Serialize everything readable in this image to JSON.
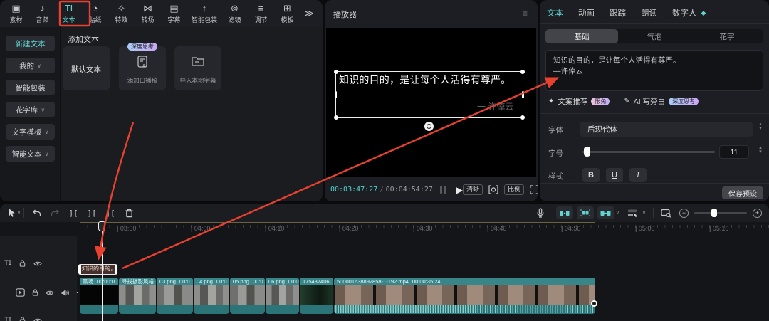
{
  "icons": {
    "more": "≫",
    "chevron_down": "∨",
    "play": "▶",
    "split": "][",
    "ellipsis": "⋯",
    "hamburger": "≡",
    "sparkle": "✦",
    "pen": "✎",
    "track_text": "TI",
    "stepper_up": "▴",
    "stepper_down": "▾",
    "minus": "−",
    "plus": "+",
    "diamond": "◆"
  },
  "toolbar": {
    "items": [
      {
        "label": "素材",
        "glyph": "▣"
      },
      {
        "label": "音频",
        "glyph": "♪"
      },
      {
        "label": "文本",
        "glyph": "TI"
      },
      {
        "label": "贴纸",
        "glyph": "◔"
      },
      {
        "label": "特效",
        "glyph": "✧"
      },
      {
        "label": "转场",
        "glyph": "⋈"
      },
      {
        "label": "字幕",
        "glyph": "▤"
      },
      {
        "label": "智能包装",
        "glyph": "↑"
      },
      {
        "label": "滤镜",
        "glyph": "⊚"
      },
      {
        "label": "调节",
        "glyph": "≡"
      },
      {
        "label": "模板",
        "glyph": "⊞"
      }
    ]
  },
  "sidebar": {
    "items": [
      {
        "label": "新建文本"
      },
      {
        "label": "我的"
      },
      {
        "label": "智能包装"
      },
      {
        "label": "花字库"
      },
      {
        "label": "文字模板"
      },
      {
        "label": "智能文本"
      }
    ]
  },
  "add_text": {
    "title": "添加文本",
    "cards": [
      {
        "label": "默认文本"
      },
      {
        "label": "添加口播稿",
        "badge": "深度思考"
      },
      {
        "label": "导入本地字幕"
      }
    ]
  },
  "player": {
    "title": "播放器",
    "overlay_text": "知识的目的，是让每个人活得有尊严。",
    "overlay_signature": "一 许倬云",
    "time_current": "00:03:47:27",
    "time_separator": "/",
    "time_total": "00:04:54:27",
    "quality_btn": "清晰",
    "ratio_btn": "比例"
  },
  "inspector": {
    "tabs": [
      {
        "label": "文本"
      },
      {
        "label": "动画"
      },
      {
        "label": "跟踪"
      },
      {
        "label": "朗读"
      },
      {
        "label": "数字人"
      }
    ],
    "subtabs": [
      {
        "label": "基础"
      },
      {
        "label": "气泡"
      },
      {
        "label": "花字"
      }
    ],
    "text_line1": "知识的目的，是让每个人活得有尊严。",
    "text_line2": "—许倬云",
    "actions": [
      {
        "label": "文案推荐",
        "badge": "限免"
      },
      {
        "label": "AI 写旁白",
        "badge": "深度思考"
      }
    ],
    "font_label": "字体",
    "font_value": "后现代体",
    "size_label": "字号",
    "size_value": "11",
    "style_label": "样式",
    "style_bold": "B",
    "style_underline": "U",
    "style_italic": "I",
    "save_button": "保存预设"
  },
  "timeline": {
    "ruler_labels": [
      "03:50",
      "04:00",
      "04:10",
      "04:20",
      "04:30",
      "04:40",
      "04:50",
      "05:00",
      "05:10"
    ],
    "text_clip_label": "知识的目的，",
    "clips": [
      {
        "name": "黑场",
        "duration": "00:00:0"
      },
      {
        "name": "寻找摄影风格",
        "duration": ""
      },
      {
        "name": "03.png",
        "duration": "00:0"
      },
      {
        "name": "04.png",
        "duration": "00:0"
      },
      {
        "name": "05.png",
        "duration": "00:0"
      },
      {
        "name": "06.png",
        "duration": "00:0"
      },
      {
        "name": "175437406",
        "duration": ""
      },
      {
        "name": "500001638892858-1-192.mp4",
        "duration": "00:00:35:24"
      }
    ]
  }
}
